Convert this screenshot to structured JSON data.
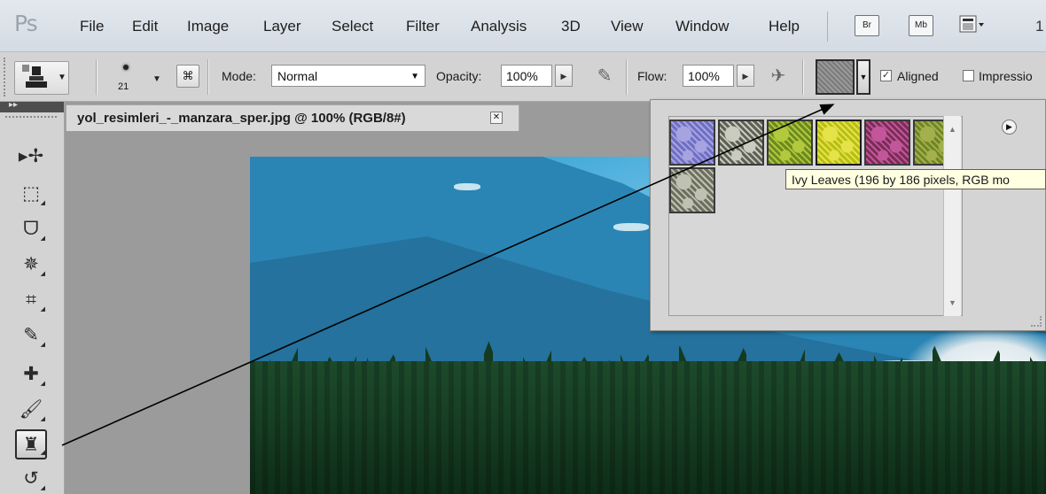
{
  "app": {
    "logo": "Ps"
  },
  "menu": {
    "items": [
      "File",
      "Edit",
      "Image",
      "Layer",
      "Select",
      "Filter",
      "Analysis",
      "3D",
      "View",
      "Window",
      "Help"
    ],
    "bridge_label": "Br",
    "minibridge_label": "Mb",
    "zoom_partial": "1"
  },
  "options": {
    "brush_size": "21",
    "mode_label": "Mode:",
    "mode_value": "Normal",
    "opacity_label": "Opacity:",
    "opacity_value": "100%",
    "flow_label": "Flow:",
    "flow_value": "100%",
    "aligned_label": "Aligned",
    "aligned_checked": true,
    "impressionist_label": "Impressio",
    "impressionist_checked": false
  },
  "document": {
    "tab_title": "yol_resimleri_-_manzara_sper.jpg @ 100% (RGB/8#)",
    "close_glyph": "✕"
  },
  "tools": {
    "collapse_glyph": "▸▸",
    "items": [
      {
        "name": "move-tool",
        "glyph": "▸✢"
      },
      {
        "name": "marquee-tool",
        "glyph": "⬚"
      },
      {
        "name": "lasso-tool",
        "glyph": "ᗜ"
      },
      {
        "name": "magic-wand-tool",
        "glyph": "✵"
      },
      {
        "name": "crop-tool",
        "glyph": "⌗"
      },
      {
        "name": "eyedropper-tool",
        "glyph": "✎"
      },
      {
        "name": "healing-brush-tool",
        "glyph": "✚"
      },
      {
        "name": "brush-tool",
        "glyph": "🖌"
      },
      {
        "name": "pattern-stamp-tool",
        "glyph": "♜",
        "active": true
      },
      {
        "name": "history-brush-tool",
        "glyph": "↺"
      }
    ]
  },
  "pattern_panel": {
    "patterns": [
      {
        "name": "pattern-1",
        "color_a": "#6e6fc4",
        "color_b": "#a7a3e0"
      },
      {
        "name": "pattern-2",
        "color_a": "#5e6155",
        "color_b": "#c9cbbf"
      },
      {
        "name": "pattern-3",
        "color_a": "#6c8a1e",
        "color_b": "#b2c83d"
      },
      {
        "name": "pattern-4",
        "color_a": "#b7bf13",
        "color_b": "#e5e24a"
      },
      {
        "name": "pattern-5",
        "color_a": "#7b2d56",
        "color_b": "#c2569b"
      },
      {
        "name": "pattern-6",
        "color_a": "#6f8628",
        "color_b": "#a4b04c"
      },
      {
        "name": "pattern-7",
        "color_a": "#6c6f5e",
        "color_b": "#bfc2b2"
      }
    ],
    "tooltip": "Ivy Leaves (196 by 186 pixels, RGB mo"
  }
}
